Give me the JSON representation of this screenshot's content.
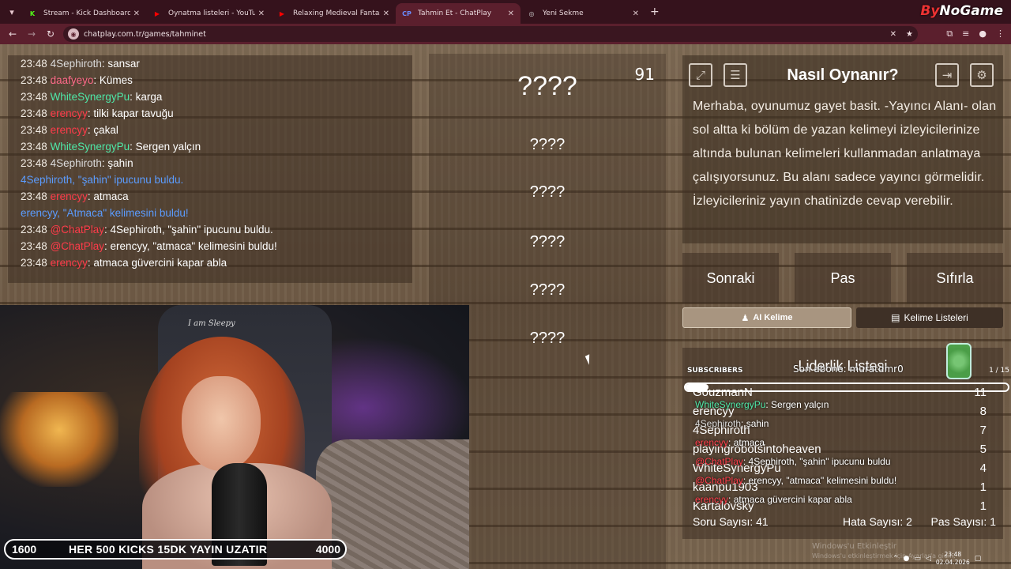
{
  "browser": {
    "tabs": [
      {
        "title": "Stream - Kick Dashboard",
        "icon": "kick-icon",
        "favicon_text": "K",
        "color": "#53fc18",
        "active": false
      },
      {
        "title": "Oynatma listeleri - YouTube",
        "icon": "youtube-icon",
        "favicon_text": "▶",
        "color": "#ff0000",
        "active": false
      },
      {
        "title": "Relaxing Medieval Fantasy",
        "icon": "youtube-icon",
        "favicon_text": "▶",
        "color": "#ff0000",
        "active": false
      },
      {
        "title": "Tahmin Et - ChatPlay",
        "icon": "chatplay-icon",
        "favicon_text": "CP",
        "color": "#6a8cff",
        "active": true
      },
      {
        "title": "Yeni Sekme",
        "icon": "chrome-icon",
        "favicon_text": "◎",
        "color": "#cccccc",
        "active": false
      }
    ],
    "url": "chatplay.com.tr/games/tahminet",
    "brand_left": "By",
    "brand_right": "NoGame"
  },
  "chat": {
    "messages": [
      {
        "time": "23:48",
        "user": "4Sephiroth",
        "user_color": "#dcdcdc",
        "text": ": sansar"
      },
      {
        "time": "23:48",
        "user": "daafyeyo",
        "user_color": "#ff6a8a",
        "text": ": Kümes"
      },
      {
        "time": "23:48",
        "user": "WhiteSynergyPu",
        "user_color": "#4ee8a8",
        "text": ": karga"
      },
      {
        "time": "23:48",
        "user": "erencyy",
        "user_color": "#ff3b4a",
        "text": ": tilki kapar tavuğu"
      },
      {
        "time": "23:48",
        "user": "erencyy",
        "user_color": "#ff3b4a",
        "text": ": çakal"
      },
      {
        "time": "23:48",
        "user": "WhiteSynergyPu",
        "user_color": "#4ee8a8",
        "text": ": Sergen yalçın"
      },
      {
        "time": "23:48",
        "user": "4Sephiroth",
        "user_color": "#dcdcdc",
        "text": ": şahin"
      },
      {
        "time": "",
        "user": "",
        "user_color": "#5b9cff",
        "text": "4Sephiroth, \"şahin\" ipucunu buldu.",
        "system": true
      },
      {
        "time": "23:48",
        "user": "erencyy",
        "user_color": "#ff3b4a",
        "text": ": atmaca"
      },
      {
        "time": "",
        "user": "",
        "user_color": "#5b9cff",
        "text": "erencyy, \"Atmaca\" kelimesini buldu!",
        "system": true
      },
      {
        "time": "23:48",
        "user": "@ChatPlay",
        "user_color": "#ff3b4a",
        "text": ": 4Sephiroth, \"şahin\" ipucunu buldu."
      },
      {
        "time": "23:48",
        "user": "@ChatPlay",
        "user_color": "#ff3b4a",
        "text": ": erencyy, \"atmaca\" kelimesini buldu!"
      },
      {
        "time": "23:48",
        "user": "erencyy",
        "user_color": "#ff3b4a",
        "text": ": atmaca güvercini kapar abla"
      }
    ]
  },
  "game": {
    "timer": "91",
    "words": [
      "????",
      "????",
      "????",
      "????",
      "????",
      "????"
    ]
  },
  "howto": {
    "title": "Nasıl Oynanır?",
    "body": "Merhaba, oyunumuz gayet basit. -Yayıncı Alanı- olan sol altta ki bölüm de yazan kelimeyi izleyicilerinize altında bulunan kelimeleri kullanmadan anlatmaya çalışıyorsunuz. Bu alanı sadece yayıncı görmelidir. İzleyicileriniz yayın chatinizde cevap verebilir."
  },
  "controls": {
    "next": "Sonraki",
    "pass": "Pas",
    "reset": "Sıfırla",
    "ai_word": "AI Kelime",
    "word_lists": "Kelime Listeleri"
  },
  "leaderboard": {
    "title": "Liderlik Listesi",
    "rows": [
      {
        "name": "GouzmanN",
        "score": "11"
      },
      {
        "name": "erencyy",
        "score": "8"
      },
      {
        "name": "4Sephiroth",
        "score": "7"
      },
      {
        "name": "playingrobotsintoheaven",
        "score": "5"
      },
      {
        "name": "WhiteSynergyPu",
        "score": "4"
      },
      {
        "name": "kaanpu1903",
        "score": "1"
      },
      {
        "name": "Kartalovsky",
        "score": "1"
      }
    ],
    "questions": "Soru Sayısı: 41",
    "errors": "Hata Sayısı: 2",
    "passes": "Pas Sayısı: 1"
  },
  "overlay": {
    "subscribers_label": "SUBSCRIBERS",
    "latest_sub": "Son abone: muratdmr0",
    "sub_count": "1 / 15",
    "sub_progress": 0.07,
    "chat_lines": [
      {
        "user": "WhiteSynergyPu",
        "user_color": "#4ee8a8",
        "text": ": Sergen yalçın"
      },
      {
        "user": "4Sephiroth",
        "user_color": "#dcdcdc",
        "text": ": şahin"
      },
      {
        "user": "erencyy",
        "user_color": "#ff3b4a",
        "text": ": atmaca"
      },
      {
        "user": "@ChatPlay",
        "user_color": "#ff3b4a",
        "text": ": 4Sephiroth, \"şahin\" ipucunu buldu"
      },
      {
        "user": "@ChatPlay",
        "user_color": "#ff3b4a",
        "text": ": erencyy, \"atmaca\" kelimesini buldu!"
      },
      {
        "user": "erencyy",
        "user_color": "#ff3b4a",
        "text": ": atmaca güvercini kapar abla"
      }
    ],
    "kicks_left": "1600",
    "kicks_message": "HER 500 KICKS 15DK YAYIN UZATIR",
    "kicks_right": "4000",
    "webcam_sign": "I am Sleepy",
    "activate_windows": "Windows'u Etkinleştir",
    "activate_windows_sub": "Windows'u etkinleştirmek için Ayarlar'a gidin."
  },
  "system_tray": {
    "time": "23:48",
    "date": "02.04.2026"
  }
}
